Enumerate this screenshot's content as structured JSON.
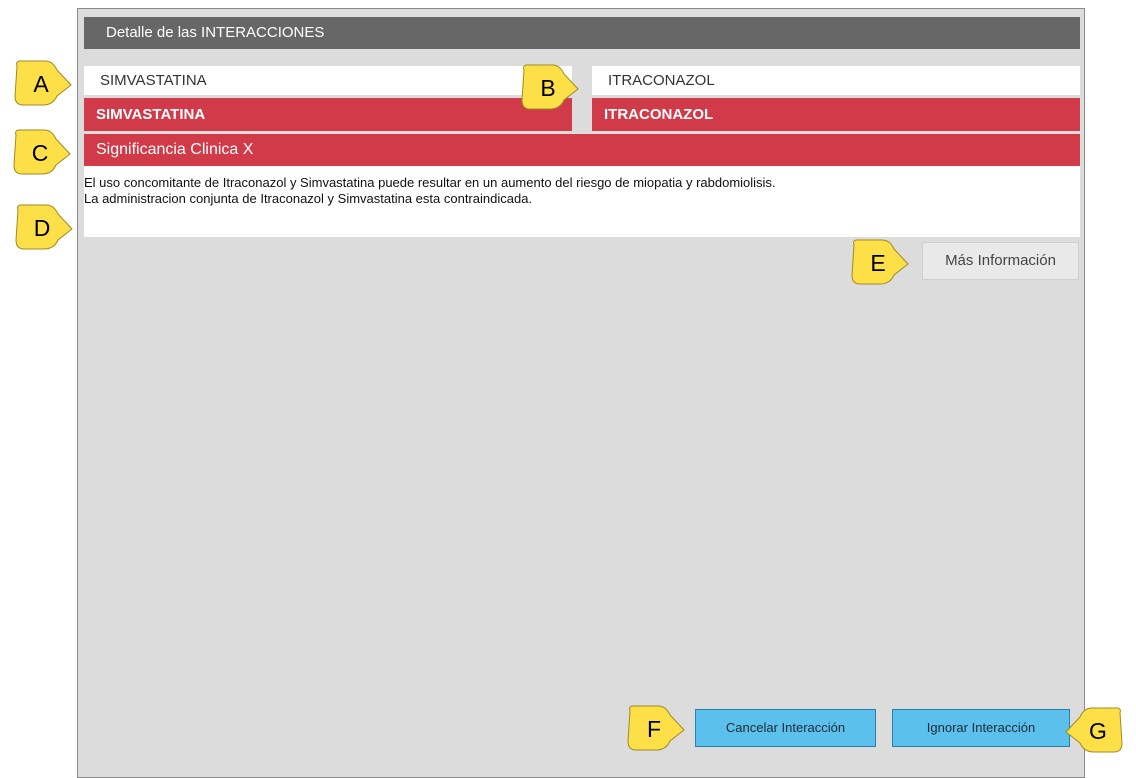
{
  "dialog": {
    "title": "Detalle de las INTERACCIONES"
  },
  "drugs": [
    {
      "name": "SIMVASTATINA",
      "tag": "SIMVASTATINA"
    },
    {
      "name": "ITRACONAZOL",
      "tag": "ITRACONAZOL"
    }
  ],
  "significance": {
    "label": "Significancia Clinica X"
  },
  "description": {
    "lines": [
      "El uso concomitante de Itraconazol y Simvastatina puede resultar en un aumento del riesgo de miopatia y rabdomiolisis.",
      "La administracion conjunta de Itraconazol y Simvastatina esta contraindicada."
    ]
  },
  "buttons": {
    "more_info": "Más Información",
    "cancel": "Cancelar Interacción",
    "ignore": "Ignorar Interacción"
  },
  "callouts": {
    "a": "A",
    "b": "B",
    "c": "C",
    "d": "D",
    "e": "E",
    "f": "F",
    "g": "G"
  },
  "colors": {
    "title_bar": "#676767",
    "alert_red": "#d13a48",
    "panel_bg": "#dcdcdc",
    "action_blue": "#5bc0eb",
    "callout_yellow": "#fde047"
  }
}
